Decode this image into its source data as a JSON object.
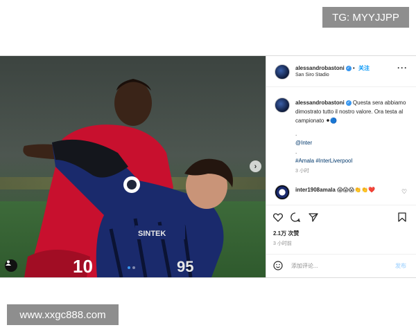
{
  "watermarks": {
    "top": "TG: MYYJJPP",
    "bottom": "www.xxgc888.com"
  },
  "post": {
    "author": "alessandrobastoni",
    "follow_label": "关注",
    "location": "San Siro Stadio",
    "caption": {
      "author": "alessandrobastoni",
      "text": "Questa sera abbiamo dimostrato tutto il nostro valore. Ora testa al campionato ⚫🔵",
      "dot1": ".",
      "mention": "@Inter",
      "dot2": ".",
      "hashtags": "#Amala #InterLiverpool",
      "time": "3 小时"
    },
    "comment": {
      "author": "inter1908amala",
      "text": "😱😱😱👏👏❤️"
    },
    "likes": "2.1万 次赞",
    "time_ago": "3 小时前",
    "comment_placeholder": "添加评论...",
    "post_button": "发布",
    "jersey": {
      "left_number": "10",
      "right_number": "95",
      "sponsor": "SOCAR? SINTEK"
    }
  },
  "icons": {
    "more": "more-options-icon",
    "verified": "verified-badge-icon",
    "next": "chevron-right-icon",
    "tag": "user-tag-icon",
    "like": "heart-icon",
    "comment": "comment-icon",
    "share": "share-icon",
    "save": "bookmark-icon",
    "emoji": "emoji-icon"
  },
  "colors": {
    "accent": "#0095f6",
    "verified": "#3897f0",
    "muted": "#8e8e8e",
    "liverpool_red": "#c8102e",
    "inter_blue": "#1a2a6c"
  },
  "carousel": {
    "slide_count": 2,
    "active_slide": 1
  }
}
